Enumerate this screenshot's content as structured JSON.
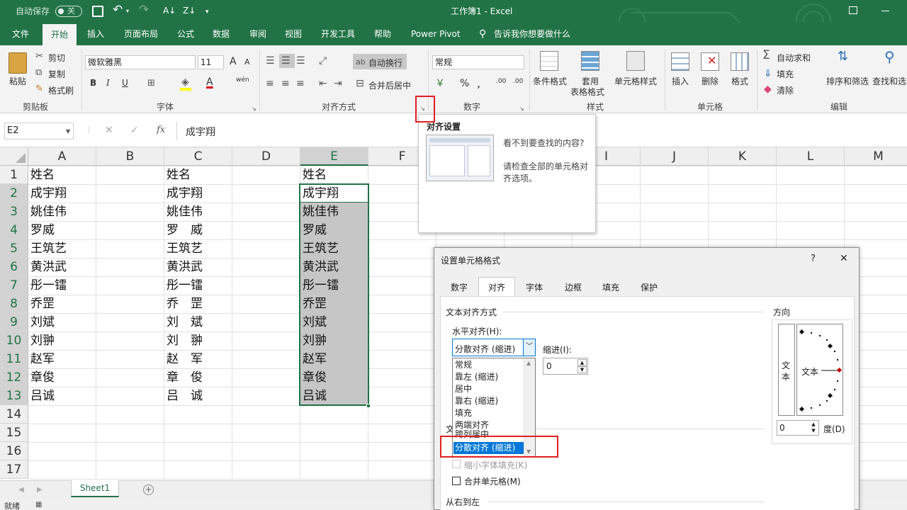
{
  "title": {
    "autosave_label": "自动保存",
    "autosave_state": "关",
    "window_title": "工作簿1  -  Excel"
  },
  "tabs": [
    "文件",
    "开始",
    "插入",
    "页面布局",
    "公式",
    "数据",
    "审阅",
    "视图",
    "开发工具",
    "帮助",
    "Power Pivot"
  ],
  "tell_me": "告诉我你想要做什么",
  "ribbon": {
    "clipboard": {
      "paste": "粘贴",
      "cut": "剪切",
      "copy": "复制",
      "format_painter": "格式刷",
      "label": "剪贴板"
    },
    "font": {
      "name": "微软雅黑",
      "size": "11",
      "label": "字体",
      "bold": "B",
      "italic": "I",
      "underline": "U",
      "grow": "A",
      "shrink": "A",
      "phonetic": "wén"
    },
    "alignment": {
      "wrap": "自动换行",
      "merge": "合并后居中",
      "label": "对齐方式"
    },
    "number": {
      "format": "常规",
      "percent": "%",
      "comma": ",",
      "inc": ".00",
      "dec": ".00",
      "label": "数字"
    },
    "styles": {
      "conditional": "条件格式",
      "table_line1": "套用",
      "table_line2": "表格格式",
      "cell_styles": "单元格样式",
      "label": "样式"
    },
    "cells": {
      "insert": "插入",
      "delete": "删除",
      "format": "格式",
      "label": "单元格"
    },
    "editing": {
      "autosum": "自动求和",
      "fill": "填充",
      "clear": "清除",
      "sort": "排序和筛选",
      "find": "查找和选",
      "label": "编辑"
    }
  },
  "formula_bar": {
    "name_box": "E2",
    "fx": "fx",
    "value": "成宇翔"
  },
  "sheet": {
    "columns": [
      "A",
      "B",
      "C",
      "D",
      "E",
      "F",
      "G",
      "H",
      "I",
      "J",
      "K",
      "L",
      "M"
    ],
    "rows": [
      "1",
      "2",
      "3",
      "4",
      "5",
      "6",
      "7",
      "8",
      "9",
      "10",
      "11",
      "12",
      "13",
      "14",
      "15",
      "16",
      "17"
    ],
    "col_a": [
      "姓名",
      "成宇翔",
      "姚佳伟",
      "罗威",
      "王筑艺",
      "黄洪武",
      "彤一镭",
      "乔罡",
      "刘斌",
      "刘翀",
      "赵军",
      "章俊",
      "吕诚"
    ],
    "col_c": [
      "姓名",
      "成宇翔",
      "姚佳伟",
      "罗　威",
      "王筑艺",
      "黄洪武",
      "彤一镭",
      "乔　罡",
      "刘　斌",
      "刘　翀",
      "赵　军",
      "章　俊",
      "吕　诚"
    ],
    "col_e": [
      "姓名",
      "成宇翔",
      "姚佳伟",
      "罗威",
      "王筑艺",
      "黄洪武",
      "彤一镭",
      "乔罡",
      "刘斌",
      "刘翀",
      "赵军",
      "章俊",
      "吕诚"
    ],
    "tab": "Sheet1",
    "status": "就绪"
  },
  "tooltip": {
    "title": "对齐设置",
    "line1": "看不到要查找的内容?",
    "line2": "请检查全部的单元格对",
    "line3": "齐选项。"
  },
  "dialog": {
    "title": "设置单元格格式",
    "help": "?",
    "close": "✕",
    "tabs": [
      "数字",
      "对齐",
      "字体",
      "边框",
      "填充",
      "保护"
    ],
    "section_text_align": "文本对齐方式",
    "horizontal_label": "水平对齐(H):",
    "horizontal_value": "分散对齐 (缩进)",
    "indent_label": "缩进(I):",
    "indent_value": "0",
    "options": [
      "常规",
      "靠左 (缩进)",
      "居中",
      "靠右 (缩进)",
      "填充",
      "两端对齐",
      "跨列居中",
      "分散对齐 (缩进)"
    ],
    "section_text_control_partial": "文",
    "shrink": "缩小字体填充(K)",
    "merge": "合并单元格(M)",
    "rtl": "从右到左",
    "orientation_label": "方向",
    "vertical_text": "文本",
    "dial_text": "文本",
    "degrees_value": "0",
    "degrees_label": "度(D)"
  },
  "colors": {
    "excel_green": "#217346",
    "selection_gray": "#c6c6c6",
    "highlight_red": "#e02020",
    "list_select": "#0078d7"
  }
}
